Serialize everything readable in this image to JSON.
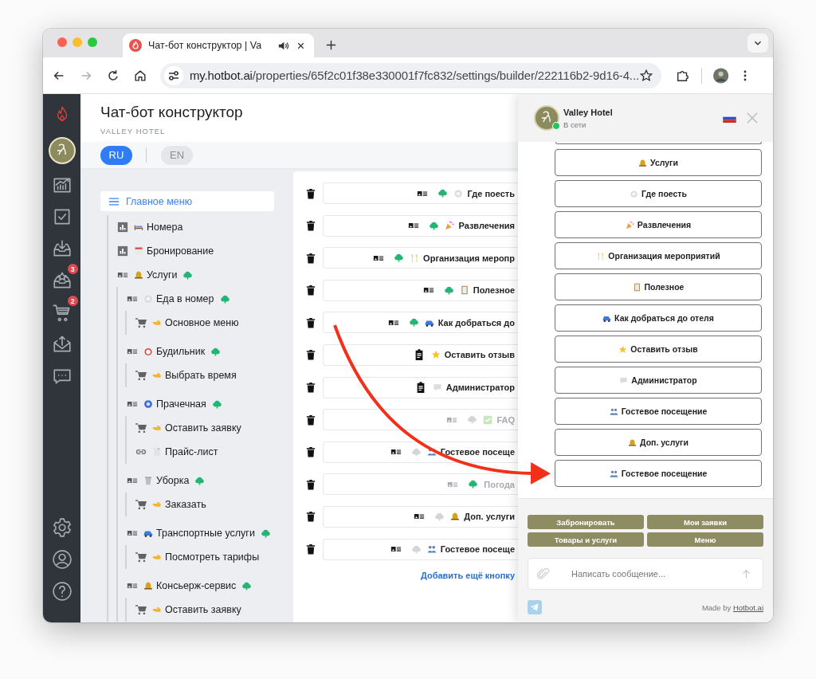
{
  "browser": {
    "tab_title": "Чат-бот конструктор | Va",
    "url_host": "my.hotbot.ai",
    "url_path": "/properties/65f2c01f38e330001f7fc832/settings/builder/222116b2-9d16-4..."
  },
  "rail": {
    "items": [
      {
        "kind": "analytics"
      },
      {
        "kind": "tasks"
      },
      {
        "kind": "inbox"
      },
      {
        "kind": "reviews",
        "badge": "3"
      },
      {
        "kind": "cart",
        "badge": "2"
      },
      {
        "kind": "outbox"
      },
      {
        "kind": "chat"
      }
    ],
    "bottom": [
      {
        "kind": "settings"
      },
      {
        "kind": "profile"
      },
      {
        "kind": "help"
      }
    ]
  },
  "header": {
    "title": "Чат-бот конструктор",
    "subtitle": "VALLEY HOTEL"
  },
  "languages": [
    {
      "label": "RU",
      "selected": true
    },
    {
      "label": "EN",
      "selected": false
    }
  ],
  "tree": {
    "label": "Главное меню",
    "selected": true,
    "children": [
      {
        "kind": "chart",
        "label": "Номера"
      },
      {
        "kind": "chart",
        "label": "Бронирование"
      },
      {
        "kind": "menu",
        "label": "Услуги",
        "ai": true,
        "children": [
          {
            "kind": "menu",
            "label": "Еда в номер",
            "ai": true,
            "children": [
              {
                "kind": "cart",
                "label": "Основное меню"
              }
            ]
          },
          {
            "kind": "menu",
            "label": "Будильник",
            "ai": true,
            "children": [
              {
                "kind": "cart",
                "label": "Выбрать время"
              }
            ]
          },
          {
            "kind": "menu",
            "label": "Прачечная",
            "ai": true,
            "children": [
              {
                "kind": "cart",
                "label": "Оставить заявку"
              },
              {
                "kind": "link",
                "label": "Прайс-лист"
              }
            ]
          },
          {
            "kind": "menu",
            "label": "Уборка",
            "ai": true,
            "children": [
              {
                "kind": "cart",
                "label": "Заказать"
              }
            ]
          },
          {
            "kind": "menu",
            "label": "Транспортные услуги",
            "ai": true,
            "children": [
              {
                "kind": "cart",
                "label": "Посмотреть тарифы"
              }
            ]
          },
          {
            "kind": "menu",
            "label": "Консьерж-сервис",
            "ai": true,
            "children": [
              {
                "kind": "cart",
                "label": "Оставить заявку"
              }
            ]
          }
        ]
      }
    ]
  },
  "buttons": {
    "rows": [
      {
        "kind": "menu",
        "ai": true,
        "label": "Где поесть",
        "dimmed": false
      },
      {
        "kind": "menu",
        "ai": true,
        "label": "Развлечения",
        "dimmed": false
      },
      {
        "kind": "menu",
        "ai": true,
        "label": "Организация меропр",
        "dimmed": false
      },
      {
        "kind": "menu",
        "ai": true,
        "label": "Полезное",
        "dimmed": false
      },
      {
        "kind": "menu",
        "ai": true,
        "label": "Как добраться до",
        "dimmed": false
      },
      {
        "kind": "form",
        "label": "Оставить отзыв",
        "dimmed": false
      },
      {
        "kind": "form",
        "label": "Администратор",
        "dimmed": false
      },
      {
        "kind": "menu",
        "ai": false,
        "label": "FAQ",
        "dimmed": true
      },
      {
        "kind": "menu",
        "ai": false,
        "label": "Гостевое посеще",
        "dimmed": false
      },
      {
        "kind": "menu",
        "ai": true,
        "label": "Погода",
        "dimmed": true
      },
      {
        "kind": "menu",
        "ai": false,
        "label": "Доп. услуги",
        "dimmed": false
      },
      {
        "kind": "menu",
        "ai": false,
        "label": "Гостевое посеще",
        "dimmed": false
      }
    ],
    "add_link": "Добавить ещё кнопку"
  },
  "chat": {
    "name": "Valley Hotel",
    "status": "В сети",
    "online": true,
    "buttons": [
      "Услуги",
      "Где поесть",
      "Развлечения",
      "Организация мероприятий",
      "Полезное",
      "Как добраться до отеля",
      "Оставить отзыв",
      "Администратор",
      "Гостевое посещение",
      "Доп. услуги",
      "Гостевое посещение"
    ],
    "quick_replies": [
      "Забронировать",
      "Мои заявки",
      "Товары и услуги",
      "Меню"
    ],
    "input": {
      "placeholder": "Написать сообщение..."
    },
    "credit": {
      "text": "Made by",
      "link": "Hotbot.ai"
    }
  }
}
